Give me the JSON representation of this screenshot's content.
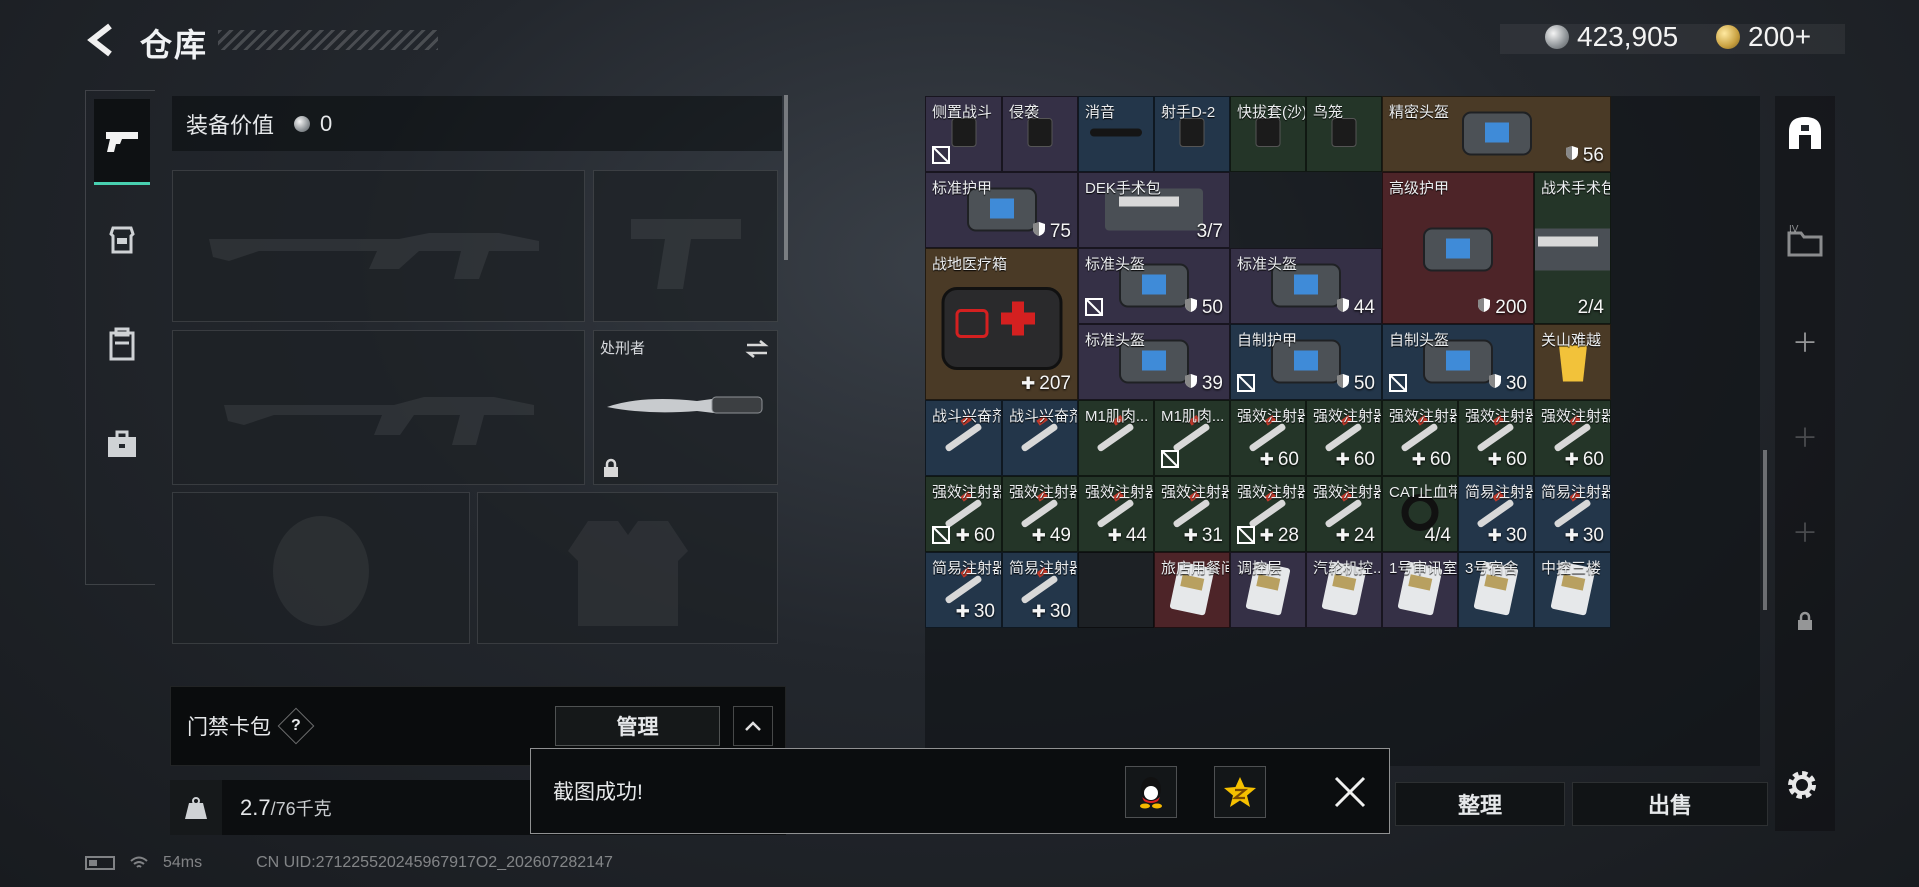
{
  "header": {
    "title": "仓库"
  },
  "currency": {
    "silver": "423,905",
    "gold": "200+"
  },
  "loadout": {
    "equip_value_label": "装备价值",
    "equip_value": "0",
    "melee_label": "处刑者",
    "keycard_label": "门禁卡包",
    "help_glyph": "?",
    "manage_label": "管理",
    "weight_value": "2.7",
    "weight_max": "/76千克"
  },
  "status": {
    "ping": "54ms",
    "uid": "CN UID:271225520245967917O2_202607282147"
  },
  "stash": {
    "items": [
      {
        "name": "侧置战斗",
        "count": "",
        "bg": "c-purple",
        "badge": true
      },
      {
        "name": "侵袭",
        "count": "",
        "bg": "c-purple"
      },
      {
        "name": "消音",
        "count": "",
        "bg": "c-blue"
      },
      {
        "name": "射手D-2",
        "count": "",
        "bg": "c-blue"
      },
      {
        "name": "快拔套(沙)",
        "count": "",
        "bg": "c-green"
      },
      {
        "name": "鸟笼",
        "count": "",
        "bg": "c-green"
      },
      {
        "name": "精密头盔",
        "count": "56",
        "bg": "c-gold",
        "armor": true
      },
      {
        "name": "标准护甲",
        "count": "75",
        "bg": "c-purple",
        "armor": true
      },
      {
        "name": "DEK手术包",
        "count": "3/7",
        "bg": "c-purple"
      },
      {
        "name": "高级护甲",
        "count": "200",
        "bg": "c-red",
        "armor": true
      },
      {
        "name": "战术手术包",
        "count": "2/4",
        "bg": "c-green"
      },
      {
        "name": "战地医疗箱",
        "count": "207",
        "bg": "c-gold",
        "plus": true
      },
      {
        "name": "标准头盔",
        "count": "50",
        "bg": "c-purple",
        "armor": true,
        "badge": true
      },
      {
        "name": "标准头盔",
        "count": "44",
        "bg": "c-purple",
        "armor": true
      },
      {
        "name": "标准头盔",
        "count": "39",
        "bg": "c-purple",
        "armor": true
      },
      {
        "name": "自制护甲",
        "count": "50",
        "bg": "c-blue",
        "armor": true,
        "badge": true
      },
      {
        "name": "自制头盔",
        "count": "30",
        "bg": "c-blue",
        "armor": true,
        "badge": true
      },
      {
        "name": "关山难越",
        "count": "",
        "bg": "c-gold"
      },
      {
        "name": "战斗兴奋剂",
        "count": "",
        "bg": "c-blue"
      },
      {
        "name": "战斗兴奋剂",
        "count": "",
        "bg": "c-blue"
      },
      {
        "name": "M1肌肉...",
        "count": "",
        "bg": "c-green"
      },
      {
        "name": "M1肌肉...",
        "count": "",
        "bg": "c-green",
        "badge": true
      },
      {
        "name": "强效注射器",
        "count": "60",
        "bg": "c-green",
        "plus": true
      },
      {
        "name": "强效注射器",
        "count": "60",
        "bg": "c-green",
        "plus": true
      },
      {
        "name": "强效注射器",
        "count": "60",
        "bg": "c-green",
        "plus": true
      },
      {
        "name": "强效注射器",
        "count": "60",
        "bg": "c-green",
        "plus": true
      },
      {
        "name": "强效注射器",
        "count": "60",
        "bg": "c-green",
        "plus": true
      },
      {
        "name": "强效注射器",
        "count": "60",
        "bg": "c-green",
        "plus": true,
        "badge": true
      },
      {
        "name": "强效注射器",
        "count": "49",
        "bg": "c-green",
        "plus": true
      },
      {
        "name": "强效注射器",
        "count": "44",
        "bg": "c-green",
        "plus": true
      },
      {
        "name": "强效注射器",
        "count": "31",
        "bg": "c-green",
        "plus": true
      },
      {
        "name": "强效注射器",
        "count": "28",
        "bg": "c-green",
        "plus": true,
        "badge": true
      },
      {
        "name": "强效注射器",
        "count": "24",
        "bg": "c-green",
        "plus": true
      },
      {
        "name": "CAT止血带",
        "count": "4/4",
        "bg": "c-green"
      },
      {
        "name": "简易注射器",
        "count": "30",
        "bg": "c-blue",
        "plus": true
      },
      {
        "name": "简易注射器",
        "count": "30",
        "bg": "c-blue",
        "plus": true
      },
      {
        "name": "简易注射器",
        "count": "30",
        "bg": "c-blue",
        "plus": true
      },
      {
        "name": "简易注射器",
        "count": "30",
        "bg": "c-blue",
        "plus": true
      },
      {
        "name": "",
        "count": "",
        "bg": "c-dark"
      },
      {
        "name": "旅店用餐间",
        "count": "",
        "bg": "c-red"
      },
      {
        "name": "调控层",
        "count": "",
        "bg": "c-purple"
      },
      {
        "name": "汽轮机控...",
        "count": "",
        "bg": "c-purple"
      },
      {
        "name": "1号审讯室",
        "count": "",
        "bg": "c-purple"
      },
      {
        "name": "3号宿舍",
        "count": "",
        "bg": "c-blue"
      },
      {
        "name": "中控三楼",
        "count": "",
        "bg": "c-blue"
      }
    ]
  },
  "buttons": {
    "sort": "整理",
    "sell": "出售"
  },
  "toast": {
    "message": "截图成功!"
  }
}
